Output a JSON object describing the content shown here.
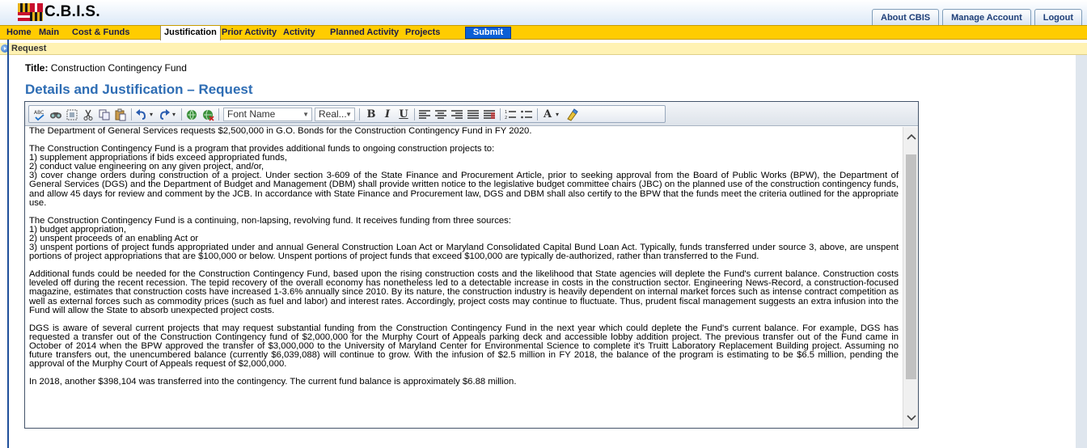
{
  "app": {
    "logo_text": "C.B.I.S."
  },
  "top_tabs": [
    {
      "label": "About CBIS"
    },
    {
      "label": "Manage Account"
    },
    {
      "label": "Logout"
    }
  ],
  "nav": {
    "items": [
      {
        "label": "Home"
      },
      {
        "label": "Main"
      },
      {
        "label": "Cost & Funds"
      },
      {
        "label": "Justification",
        "active": true
      },
      {
        "label": "Prior Activity"
      },
      {
        "label": "Activity"
      },
      {
        "label": "Planned Activity"
      },
      {
        "label": "Projects"
      }
    ],
    "submit_label": "Submit"
  },
  "breadcrumb": {
    "label": "Request"
  },
  "page": {
    "title_label": "Title:",
    "title_value": "Construction Contingency Fund",
    "heading": "Details and Justification – Request"
  },
  "toolbar": {
    "font_name": "Font Name",
    "font_size": "Real...",
    "icons": [
      "spellcheck-icon",
      "find-icon",
      "select-all-icon",
      "cut-icon",
      "copy-icon",
      "paste-icon",
      "undo-icon",
      "redo-icon",
      "link-icon",
      "unlink-icon",
      "bold-icon",
      "italic-icon",
      "underline-icon",
      "align-left-icon",
      "align-center-icon",
      "align-right-icon",
      "justify-icon",
      "justify-full-icon",
      "ordered-list-icon",
      "unordered-list-icon",
      "font-color-icon",
      "clear-format-icon"
    ]
  },
  "content": {
    "p1": "The Department of General Services requests $2,500,000 in G.O. Bonds for the Construction Contingency Fund in FY 2020.",
    "p2_l1": "The Construction Contingency Fund is a program that provides additional funds to ongoing construction projects to:",
    "p2_l2": "1) supplement appropriations if bids exceed appropriated funds,",
    "p2_l3": "2) conduct value engineering on any given project, and/or,",
    "p2_l4": "3) cover change orders during construction of a project. Under section 3-609 of the State Finance and Procurement Article, prior to seeking approval from the Board of Public Works (BPW), the Department of General Services (DGS) and the Department of Budget and Management (DBM) shall provide written notice to the legislative budget committee chairs (JBC) on the planned use of the construction contingency funds, and allow 45 days for review and comment by the JCB. In accordance with State Finance and Procurement law, DGS and DBM shall also certify to the BPW that the funds meet the criteria outlined for the appropriate use.",
    "p3_l1": "The Construction Contingency Fund is a continuing, non-lapsing, revolving fund. It receives funding from three sources:",
    "p3_l2": "1) budget appropriation,",
    "p3_l3": "2) unspent proceeds of an enabling Act or",
    "p3_l4": "3) unspent portions of project funds appropriated under and annual General Construction Loan Act or Maryland Consolidated Capital Bund Loan Act. Typically, funds transferred under source 3, above, are unspent portions of project appropriations that are $100,000 or below. Unspent portions of project funds that exceed $100,000 are typically de-authorized, rather than transferred to the Fund.",
    "p4": "Additional funds could be needed for the Construction Contingency Fund, based upon the rising construction costs and the likelihood that State agencies will deplete the Fund's current balance. Construction costs leveled off during the recent recession. The tepid recovery of the overall economy has nonetheless led to a detectable increase in costs in the construction sector. Engineering News-Record, a construction-focused magazine, estimates that construction costs have increased 1-3.6% annually since 2010. By its nature, the construction industry is heavily dependent on internal market forces such as intense contract competition as well as external forces such as commodity prices (such as fuel and labor) and interest rates. Accordingly, project costs may continue to fluctuate. Thus, prudent fiscal management suggests an extra infusion into the Fund will allow the State to absorb unexpected project costs.",
    "p5": "DGS is aware of several current projects that may request substantial funding from the Construction Contingency Fund in the next year which could deplete the Fund's current balance. For example, DGS has requested a transfer out of the Construction Contingency fund of $2,000,000 for the Murphy Court of Appeals parking deck and accessible lobby addition project. The previous transfer out of the Fund came in October of 2014 when the BPW approved the transfer of $3,000,000 to the University of Maryland Center for Environmental Science to complete it's Truitt Laboratory Replacement Building project. Assuming no future transfers out, the unencumbered balance (currently $6,039,088) will continue to grow. With the infusion of $2.5 million in FY 2018, the balance of the program is estimating to be $6.5 million, pending the approval of the Murphy Court of Appeals request of $2,000,000.",
    "p6": "In 2018, another $398,104 was transferred into the contingency. The current fund balance is approximately $6.88 million."
  }
}
